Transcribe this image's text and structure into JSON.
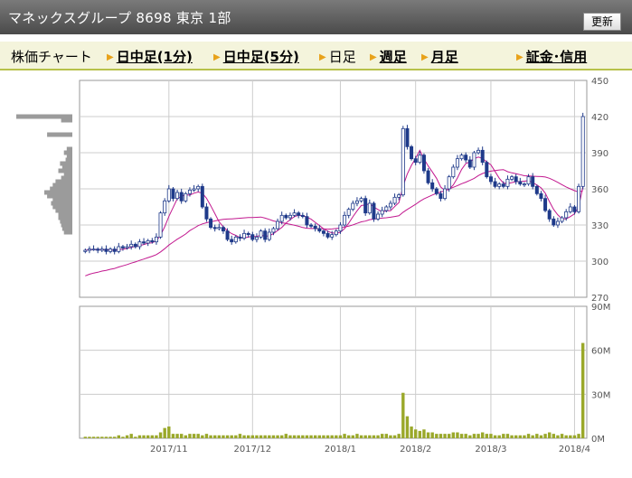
{
  "header": {
    "title": "マネックスグループ 8698 東京 1部",
    "refresh_label": "更新"
  },
  "tabs": [
    {
      "label": "株価チャート",
      "link": false,
      "arrow": false
    },
    {
      "label": "日中足(1分)",
      "link": true,
      "arrow": true
    },
    {
      "label": "日中足(5分)",
      "link": true,
      "arrow": true
    },
    {
      "label": "日足",
      "link": false,
      "arrow": true
    },
    {
      "label": "週足",
      "link": true,
      "arrow": true
    },
    {
      "label": "月足",
      "link": true,
      "arrow": true
    },
    {
      "label": "証金･信用",
      "link": true,
      "arrow": true
    }
  ],
  "colors": {
    "candle": "#1f3a8a",
    "ma_short": "#c2188f",
    "ma_long": "#c2188f",
    "volume": "#9aa82a",
    "volume_profile": "#9b9b9b",
    "grid": "#cccccc"
  },
  "chart_data": [
    {
      "type": "candlestick",
      "title": "",
      "xlabel": "",
      "ylabel": "",
      "ylim": [
        270,
        450
      ],
      "y_ticks": [
        "450",
        "420",
        "390",
        "360",
        "330",
        "300",
        "270"
      ],
      "x_ticks": [
        "2017/11",
        "2017/12",
        "2018/1",
        "2018/2",
        "2018/3",
        "2018/4"
      ],
      "x_tick_index": [
        20,
        40,
        61,
        79,
        97,
        117
      ],
      "grid": true,
      "closes": [
        309,
        310,
        310,
        309,
        310,
        308,
        310,
        308,
        312,
        311,
        312,
        314,
        312,
        316,
        315,
        317,
        316,
        320,
        340,
        350,
        360,
        352,
        357,
        350,
        356,
        359,
        360,
        362,
        345,
        335,
        328,
        327,
        328,
        325,
        318,
        316,
        320,
        319,
        323,
        322,
        318,
        320,
        325,
        318,
        324,
        327,
        333,
        338,
        336,
        338,
        340,
        338,
        337,
        330,
        329,
        327,
        325,
        323,
        320,
        322,
        325,
        330,
        338,
        343,
        348,
        350,
        352,
        340,
        348,
        335,
        339,
        342,
        345,
        348,
        353,
        355,
        410,
        395,
        385,
        382,
        388,
        375,
        365,
        360,
        356,
        352,
        360,
        370,
        378,
        385,
        388,
        384,
        378,
        390,
        392,
        382,
        370,
        366,
        362,
        364,
        362,
        368,
        370,
        366,
        364,
        364,
        370,
        362,
        356,
        352,
        342,
        335,
        330,
        333,
        336,
        341,
        345,
        341,
        362,
        420
      ],
      "ma_short_label": "",
      "ma_long_label": "",
      "volume_profile": [
        {
          "price": 420,
          "weight": 1.0
        },
        {
          "price": 417,
          "weight": 0.2
        },
        {
          "price": 405,
          "weight": 0.45
        },
        {
          "price": 393,
          "weight": 0.1
        },
        {
          "price": 390,
          "weight": 0.15
        },
        {
          "price": 387,
          "weight": 0.1
        },
        {
          "price": 384,
          "weight": 0.12
        },
        {
          "price": 381,
          "weight": 0.22
        },
        {
          "price": 378,
          "weight": 0.18
        },
        {
          "price": 375,
          "weight": 0.25
        },
        {
          "price": 372,
          "weight": 0.15
        },
        {
          "price": 369,
          "weight": 0.2
        },
        {
          "price": 366,
          "weight": 0.3
        },
        {
          "price": 363,
          "weight": 0.35
        },
        {
          "price": 360,
          "weight": 0.4
        },
        {
          "price": 357,
          "weight": 0.5
        },
        {
          "price": 354,
          "weight": 0.45
        },
        {
          "price": 351,
          "weight": 0.35
        },
        {
          "price": 348,
          "weight": 0.38
        },
        {
          "price": 345,
          "weight": 0.35
        },
        {
          "price": 342,
          "weight": 0.3
        },
        {
          "price": 339,
          "weight": 0.25
        },
        {
          "price": 336,
          "weight": 0.25
        },
        {
          "price": 333,
          "weight": 0.22
        },
        {
          "price": 330,
          "weight": 0.2
        },
        {
          "price": 327,
          "weight": 0.18
        },
        {
          "price": 324,
          "weight": 0.15
        }
      ]
    },
    {
      "type": "bar",
      "title": "",
      "xlabel": "",
      "ylabel": "",
      "ylim": [
        0,
        90
      ],
      "y_ticks": [
        "90M",
        "60M",
        "30M",
        "0M"
      ],
      "values": [
        1,
        1,
        1,
        1,
        1,
        1,
        1,
        1,
        2,
        1,
        2,
        3,
        1,
        2,
        2,
        2,
        2,
        2,
        4,
        7,
        8,
        3,
        3,
        3,
        2,
        3,
        3,
        3,
        2,
        3,
        2,
        2,
        2,
        2,
        2,
        2,
        2,
        3,
        2,
        2,
        2,
        2,
        2,
        2,
        2,
        2,
        2,
        2,
        3,
        2,
        2,
        2,
        2,
        2,
        2,
        2,
        2,
        2,
        2,
        2,
        2,
        2,
        3,
        2,
        2,
        3,
        2,
        2,
        2,
        2,
        2,
        3,
        3,
        2,
        2,
        3,
        31,
        15,
        8,
        6,
        5,
        6,
        4,
        4,
        3,
        3,
        3,
        3,
        4,
        4,
        3,
        3,
        2,
        3,
        3,
        4,
        3,
        3,
        2,
        2,
        3,
        3,
        2,
        2,
        2,
        2,
        3,
        2,
        3,
        2,
        3,
        4,
        3,
        2,
        3,
        2,
        2,
        2,
        3,
        65
      ]
    }
  ]
}
